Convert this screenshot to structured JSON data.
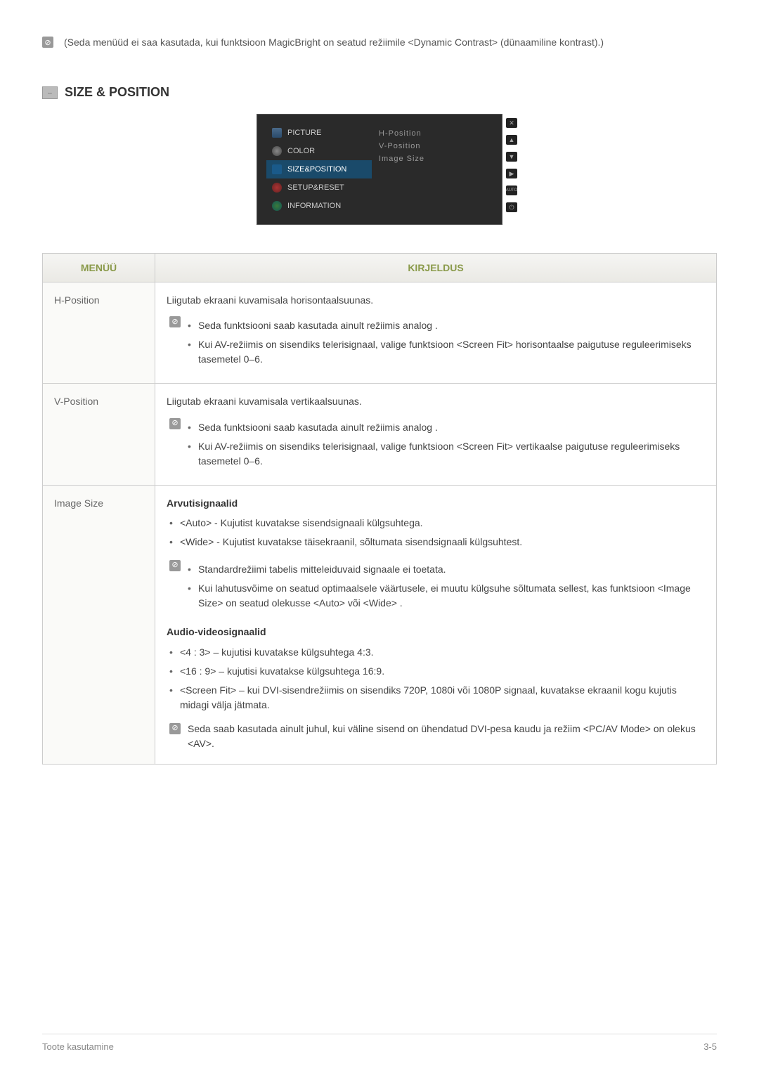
{
  "top_note": "(Seda menüüd ei saa kasutada, kui funktsioon MagicBright on seatud režiimile <Dynamic Contrast> (dünaamiline kontrast).)",
  "section_title": "SIZE & POSITION",
  "osd": {
    "left": [
      "PICTURE",
      "COLOR",
      "SIZE&POSITION",
      "SETUP&RESET",
      "INFORMATION"
    ],
    "right": [
      "H-Position",
      "V-Position",
      "Image Size"
    ],
    "side": [
      "✕",
      "▲",
      "▼",
      "▶",
      "AUTO",
      "⏻"
    ]
  },
  "table": {
    "headers": {
      "menu": "MENÜÜ",
      "desc": "KIRJELDUS"
    },
    "rows": [
      {
        "label": "H-Position",
        "intro": "Liigutab ekraani kuvamisala horisontaalsuunas.",
        "bullets": [
          "Seda funktsiooni saab kasutada ainult režiimis analog .",
          "Kui AV-režiimis on sisendiks telerisignaal, valige funktsioon <Screen Fit> horisontaalse paigutuse reguleerimiseks tasemetel 0–6."
        ]
      },
      {
        "label": "V-Position",
        "intro": "Liigutab ekraani kuvamisala vertikaalsuunas.",
        "bullets": [
          "Seda funktsiooni saab kasutada ainult režiimis analog .",
          "Kui AV-režiimis on sisendiks telerisignaal, valige funktsioon <Screen Fit> vertikaalse paigutuse reguleerimiseks tasemetel 0–6."
        ]
      },
      {
        "label": "Image Size",
        "h1": "Arvutisignaalid",
        "b1": [
          "<Auto> - Kujutist kuvatakse sisendsignaali külgsuhtega.",
          "<Wide> - Kujutist kuvatakse täisekraanil, sõltumata sisendsignaali külgsuhtest."
        ],
        "note_bullets": [
          "Standardrežiimi tabelis mitteleiduvaid signaale ei toetata.",
          "Kui lahutusvõime on seatud optimaalsele väärtusele, ei muutu külgsuhe sõltumata sellest, kas funktsioon <Image Size> on seatud olekusse <Auto> või <Wide> ."
        ],
        "h2": "Audio-videosignaalid",
        "b2": [
          "<4 : 3> – kujutisi kuvatakse külgsuhtega 4:3.",
          "<16 : 9> – kujutisi kuvatakse külgsuhtega 16:9.",
          "<Screen Fit> – kui DVI-sisendrežiimis on sisendiks 720P, 1080i või 1080P signaal, kuvatakse ekraanil kogu kujutis midagi välja jätmata."
        ],
        "end_note": "Seda saab kasutada ainult juhul, kui väline sisend on ühendatud DVI-pesa kaudu ja režiim <PC/AV Mode> on olekus <AV>."
      }
    ]
  },
  "footer": {
    "left": "Toote kasutamine",
    "right": "3-5"
  }
}
